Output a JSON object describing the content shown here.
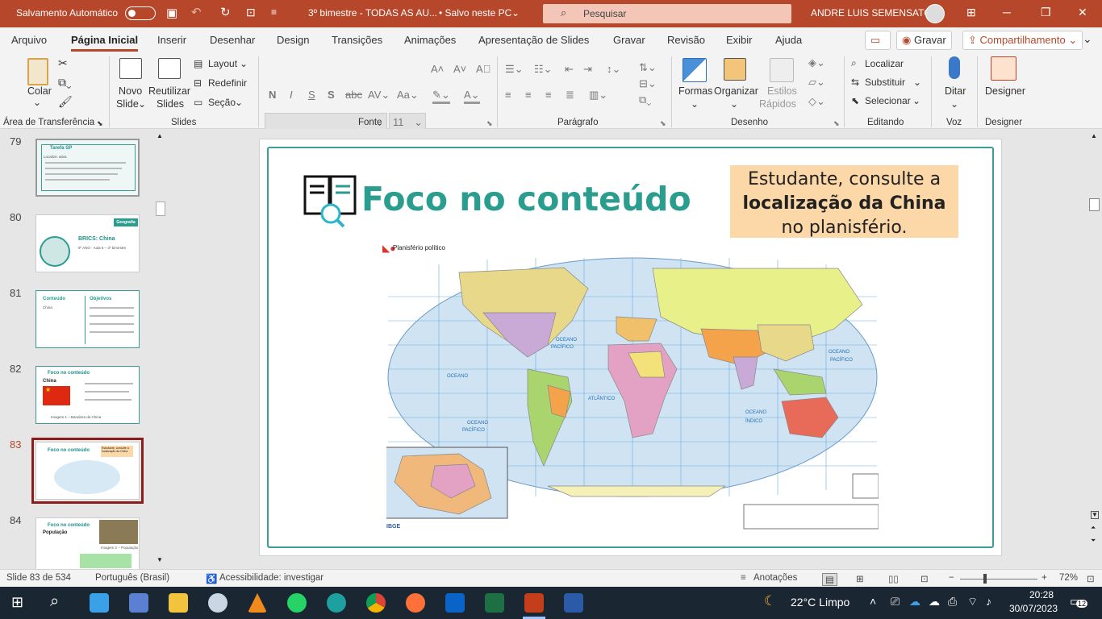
{
  "titlebar": {
    "autosave_label": "Salvamento Automático",
    "doc_title": "3º bimestre - TODAS AS AU...",
    "save_status": "• Salvo neste PC",
    "search_placeholder": "Pesquisar",
    "user_name": "ANDRE LUIS SEMENSATO"
  },
  "tabs": [
    "Arquivo",
    "Página Inicial",
    "Inserir",
    "Desenhar",
    "Design",
    "Transições",
    "Animações",
    "Apresentação de Slides",
    "Gravar",
    "Revisão",
    "Exibir",
    "Ajuda"
  ],
  "record_button": "Gravar",
  "share_button": "Compartilhamento",
  "ribbon": {
    "clipboard": {
      "paste": "Colar",
      "group": "Área de Transferência"
    },
    "slides": {
      "new_slide_1": "Novo",
      "new_slide_2": "Slide",
      "reuse_1": "Reutilizar",
      "reuse_2": "Slides",
      "layout": "Layout",
      "reset": "Redefinir",
      "section": "Seção",
      "group": "Slides"
    },
    "font": {
      "size": "11",
      "group": "Fonte"
    },
    "paragraph": {
      "group": "Parágrafo"
    },
    "drawing": {
      "shapes": "Formas",
      "arrange": "Organizar",
      "quick_styles_1": "Estilos",
      "quick_styles_2": "Rápidos",
      "group": "Desenho"
    },
    "editing": {
      "find": "Localizar",
      "replace": "Substituir",
      "select": "Selecionar",
      "group": "Editando"
    },
    "voice": {
      "dictate": "Ditar",
      "group": "Voz"
    },
    "designer": {
      "label": "Designer",
      "group": "Designer"
    }
  },
  "slides_panel": [
    {
      "num": "79",
      "title": "Tarefa SP",
      "line": "Localize: ativa"
    },
    {
      "num": "80",
      "title": "BRICS: China",
      "line": "9º ANO · Aula 6 – 3º bimestre",
      "badge": "Geografia"
    },
    {
      "num": "81",
      "title": "Conteúdo",
      "title2": "Objetivos",
      "line": "China"
    },
    {
      "num": "82",
      "title": "Foco no conteúdo",
      "title2": "China",
      "line": "Imagem 1 – Bandeira da China"
    },
    {
      "num": "83",
      "title": "Foco no conteúdo",
      "line": "Estudante, consulte a localização da China"
    },
    {
      "num": "84",
      "title": "Foco no conteúdo",
      "title2": "População",
      "line": "Imagem 2 – População"
    }
  ],
  "current_slide": {
    "title": "Foco no conteúdo",
    "note_line1": "Estudante, consulte a",
    "note_line2": "localização da China",
    "note_line3": "no planisfério.",
    "map_label": "Planisfério político",
    "map_ocean_labels": [
      "OCEANO",
      "PACÍFICO",
      "OCEANO",
      "ATLÂNTICO",
      "OCEANO",
      "PACÍFICO",
      "OCEANO",
      "ÍNDICO",
      "OCEANO",
      "PACÍFICO"
    ],
    "map_source": "IBGE"
  },
  "statusbar": {
    "slide_info": "Slide 83 de 534",
    "language": "Português (Brasil)",
    "accessibility": "Acessibilidade: investigar",
    "notes": "Anotações",
    "zoom": "72%"
  },
  "taskbar": {
    "weather": "22°C  Limpo",
    "time": "20:28",
    "date": "30/07/2023",
    "notifications": "12"
  },
  "colors": {
    "accent": "#b7472a",
    "teal": "#2a9d8f",
    "note_bg": "#fcd7a7"
  }
}
